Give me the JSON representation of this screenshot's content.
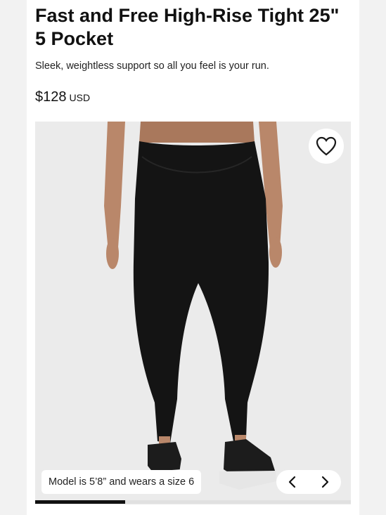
{
  "product": {
    "title_line1": "Fast and Free High-Rise Tight 25\"",
    "title_line2": "5 Pocket",
    "subtitle": "Sleek, weightless support so all you feel is your run.",
    "price": "$128",
    "currency": "USD"
  },
  "gallery": {
    "caption": "Model is 5’8” and wears a size 6",
    "favorite_icon": "heart-outline-icon",
    "prev_icon": "chevron-left-icon",
    "next_icon": "chevron-right-icon",
    "progress_fraction": 0.285
  },
  "colors": {
    "text": "#111111",
    "image_background": "#ebebeb",
    "leggings": "#141414",
    "progress": "#111111"
  }
}
